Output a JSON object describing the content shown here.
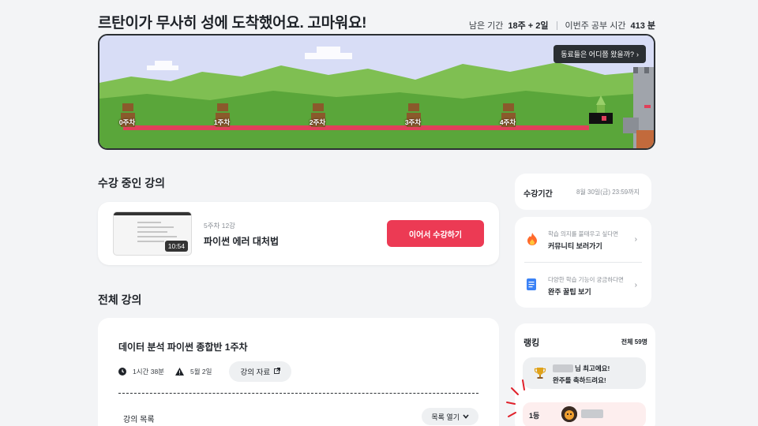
{
  "header": {
    "headline": "르탄이가 무사히 성에 도착했어요. 고마워요!",
    "remaining_label": "남은 기간",
    "remaining_value": "18주 + 2일",
    "study_label": "이번주 공부 시간",
    "study_value": "413 분"
  },
  "map": {
    "tooltip": "동료들은 어디쯤 왔을까?",
    "weeks": [
      "0주차",
      "1주차",
      "2주차",
      "3주차",
      "4주차"
    ],
    "colors": {
      "sky": "#d8ddf6",
      "hill_back": "#7fbf52",
      "hill_front": "#5aa63a",
      "path": "#e0405a"
    }
  },
  "current": {
    "section_title": "수강 중인 강의",
    "meta": "5주차 12강",
    "title": "파이썬 에러 대처법",
    "duration": "10:54",
    "continue_label": "이어서 수강하기"
  },
  "all_lectures": {
    "section_title": "전체 강의",
    "course_name": "데이터 분석 파이썬 종합반 1주차",
    "time": "1시간 38분",
    "date": "5월 2일",
    "material_label": "강의 자료",
    "list_title": "강의 목록",
    "list_toggle": "목록 열기"
  },
  "sidebar": {
    "period_label": "수강기간",
    "period_value": "8월 30일(금) 23:59까지",
    "links": [
      {
        "sub": "학습 의지를 불태우고 싶다면",
        "main": "커뮤니티 보러가기",
        "icon": "fire-icon"
      },
      {
        "sub": "다양한 학습 기능이 궁금하다면",
        "main": "완주 꿀팁 보기",
        "icon": "document-icon"
      }
    ],
    "ranking": {
      "title": "랭킹",
      "total": "전체 59명",
      "congrats_line1": "님 최고에요!",
      "congrats_line2": "완주를 축하드려요!",
      "first_place": "1등"
    }
  },
  "accent": "#ec3a54"
}
